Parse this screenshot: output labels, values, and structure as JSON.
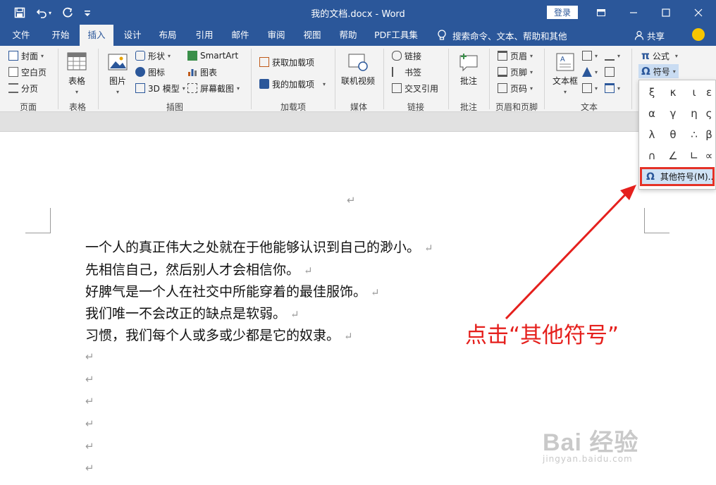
{
  "window": {
    "title": "我的文档.docx - Word",
    "login_label": "登录"
  },
  "tabs": [
    {
      "label": "文件"
    },
    {
      "label": "开始"
    },
    {
      "label": "插入",
      "active": true
    },
    {
      "label": "设计"
    },
    {
      "label": "布局"
    },
    {
      "label": "引用"
    },
    {
      "label": "邮件"
    },
    {
      "label": "审阅"
    },
    {
      "label": "视图"
    },
    {
      "label": "帮助"
    },
    {
      "label": "PDF工具集"
    }
  ],
  "tell_me": "搜索命令、文本、帮助和其他",
  "share_label": "共享",
  "ribbon": {
    "pages": {
      "cover": "封面",
      "blank": "空白页",
      "break": "分页",
      "group": "页面"
    },
    "tables": {
      "table": "表格",
      "group": "表格"
    },
    "illustrations": {
      "picture": "图片",
      "shapes": "形状",
      "icons": "图标",
      "model3d": "3D 模型",
      "smartart": "SmartArt",
      "chart": "图表",
      "screenshot": "屏幕截图",
      "group": "插图"
    },
    "addins": {
      "get": "获取加载项",
      "my": "我的加载项",
      "group": "加载项"
    },
    "media": {
      "video": "联机视频",
      "group": "媒体"
    },
    "links": {
      "link": "链接",
      "bookmark": "书签",
      "crossref": "交叉引用",
      "group": "链接"
    },
    "comments": {
      "comment": "批注",
      "group": "批注"
    },
    "header_footer": {
      "header": "页眉",
      "footer": "页脚",
      "page_number": "页码",
      "group": "页眉和页脚"
    },
    "text": {
      "textbox": "文本框",
      "group": "文本"
    },
    "symbols": {
      "equation": "公式",
      "symbol": "符号"
    }
  },
  "symbol_menu": {
    "symbols": [
      "ξ",
      "κ",
      "ι",
      "ε",
      "α",
      "γ",
      "η",
      "ς",
      "λ",
      "θ",
      "∴",
      "β",
      "∩",
      "∠",
      "∟",
      "∝"
    ],
    "more_label": "其他符号(M)..."
  },
  "document": {
    "lines": [
      "一个人的真正伟大之处就在于他能够认识到自己的渺小。",
      "先相信自己，然后别人才会相信你。",
      "好脾气是一个人在社交中所能穿着的最佳服饰。",
      "我们唯一不会改正的缺点是软弱。",
      "习惯，我们每个人或多或少都是它的奴隶。"
    ],
    "para_mark": "↵"
  },
  "annotation": {
    "text": "点击“其他符号”",
    "color": "#e5201d"
  },
  "watermark": {
    "main": "Bai 经验",
    "sub": "jingyan.baidu.com"
  },
  "colors": {
    "brand": "#2b579a",
    "highlight": "#e53227"
  }
}
